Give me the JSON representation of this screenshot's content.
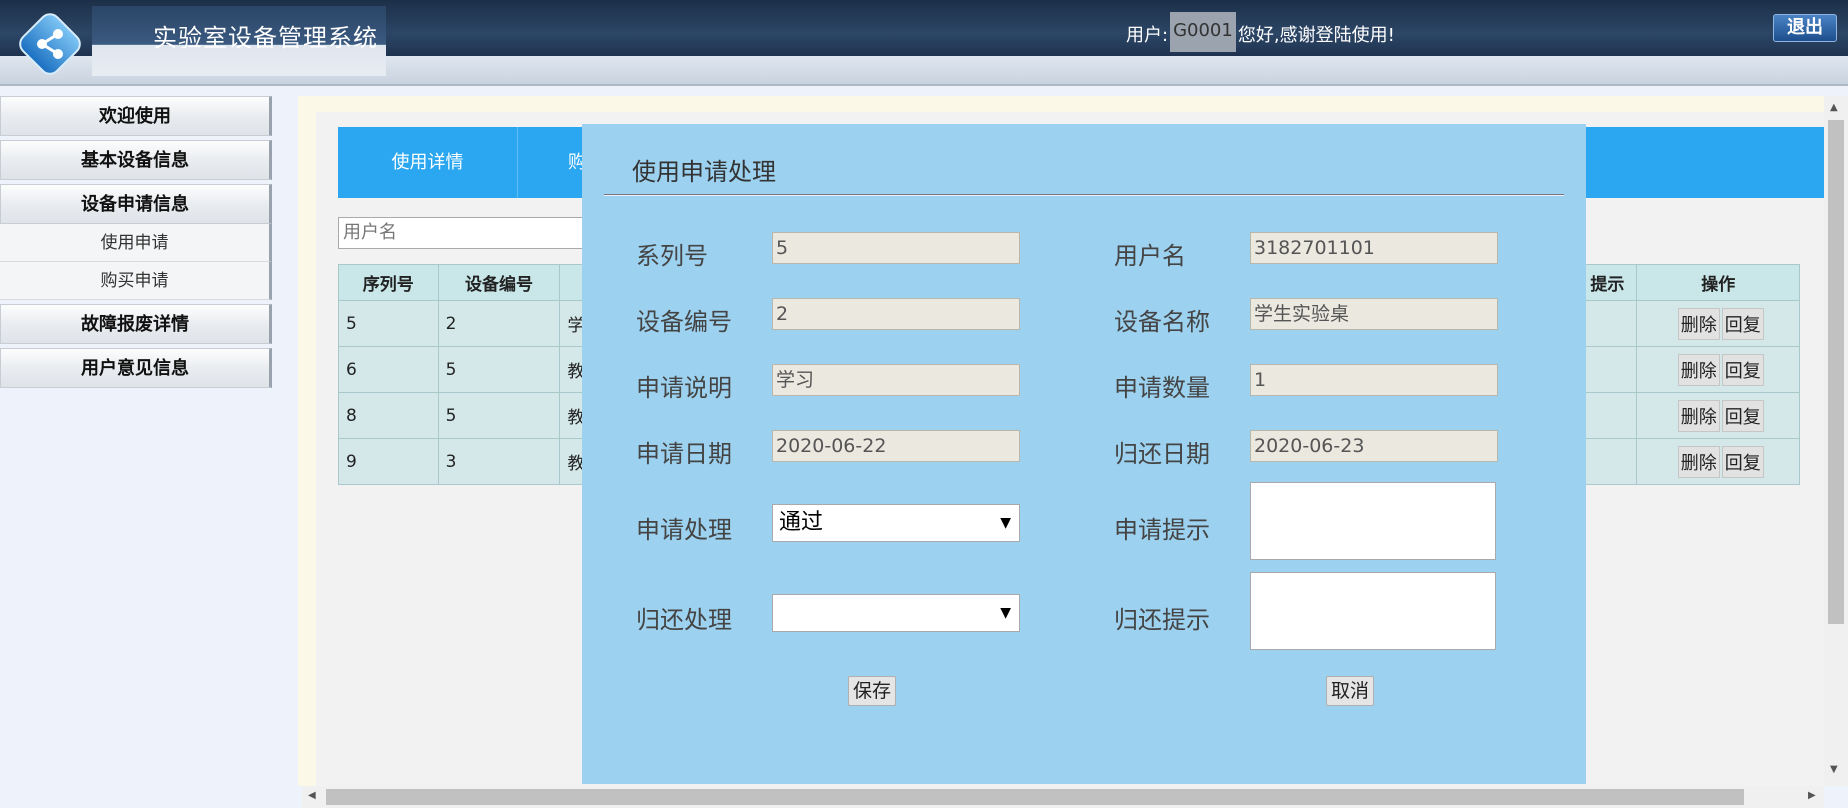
{
  "header": {
    "system_title": "实验室设备管理系统",
    "user_label": "用户:",
    "user_id": "G0001",
    "welcome": "您好,感谢登陆使用!",
    "logout_label": "退出"
  },
  "sidebar": {
    "items": [
      {
        "label": "欢迎使用"
      },
      {
        "label": "基本设备信息"
      },
      {
        "label": "设备申请信息"
      },
      {
        "label": "使用申请"
      },
      {
        "label": "购买申请"
      },
      {
        "label": "故障报废详情"
      },
      {
        "label": "用户意见信息"
      }
    ]
  },
  "main": {
    "tabs": [
      {
        "label": "使用详情"
      },
      {
        "label": "购"
      }
    ],
    "search_placeholder": "用户名",
    "table": {
      "headers": [
        "序列号",
        "设备编号",
        "提示",
        "操作"
      ],
      "rows": [
        {
          "id": "5",
          "device": "2",
          "name": "学"
        },
        {
          "id": "6",
          "device": "5",
          "name": "教"
        },
        {
          "id": "8",
          "device": "5",
          "name": "教"
        },
        {
          "id": "9",
          "device": "3",
          "name": "教"
        }
      ],
      "delete_label": "删除",
      "reply_label": "回复"
    }
  },
  "modal": {
    "title": "使用申请处理",
    "fields": {
      "serial_label": "系列号",
      "serial_value": "5",
      "username_label": "用户名",
      "username_value": "3182701101",
      "device_no_label": "设备编号",
      "device_no_value": "2",
      "device_name_label": "设备名称",
      "device_name_value": "学生实验桌",
      "desc_label": "申请说明",
      "desc_value": "学习",
      "qty_label": "申请数量",
      "qty_value": "1",
      "date_label": "申请日期",
      "date_value": "2020-06-22",
      "return_date_label": "归还日期",
      "return_date_value": "2020-06-23",
      "process_label": "申请处理",
      "process_value": "通过",
      "hint_label": "申请提示",
      "return_process_label": "归还处理",
      "return_process_value": "",
      "return_hint_label": "归还提示"
    },
    "save_label": "保存",
    "cancel_label": "取消"
  }
}
